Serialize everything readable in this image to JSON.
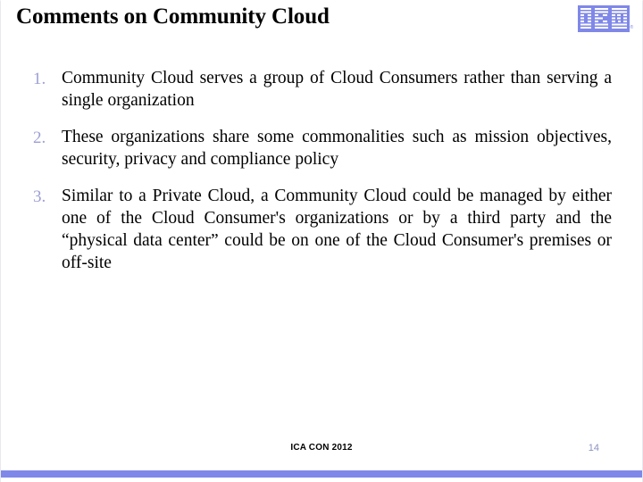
{
  "slide": {
    "title": "Comments on Community Cloud",
    "logo": {
      "name": "ibm-logo",
      "text": "IBM",
      "trademark": "®",
      "color": "#7f88e8"
    },
    "bullets": [
      {
        "marker": "1.",
        "text": "Community Cloud serves a group of Cloud Consumers rather than serving a single organization"
      },
      {
        "marker": "2.",
        "text": "These organizations share some commonalities such as mission objectives, security, privacy and compliance policy"
      },
      {
        "marker": "3.",
        "text": "Similar to a Private Cloud, a Community Cloud could be managed by either one of the Cloud Consumer's organizations or by a third party and the “physical data center” could be on one of the Cloud Consumer's premises or off-site"
      }
    ],
    "footer": {
      "center_text": "ICA CON 2012",
      "page_number": "14",
      "page_number_color": "#8a93c0",
      "bar_color": "#7f88e8"
    },
    "colors": {
      "marker": "#9da0d4",
      "text": "#000000",
      "background": "#ffffff"
    }
  }
}
